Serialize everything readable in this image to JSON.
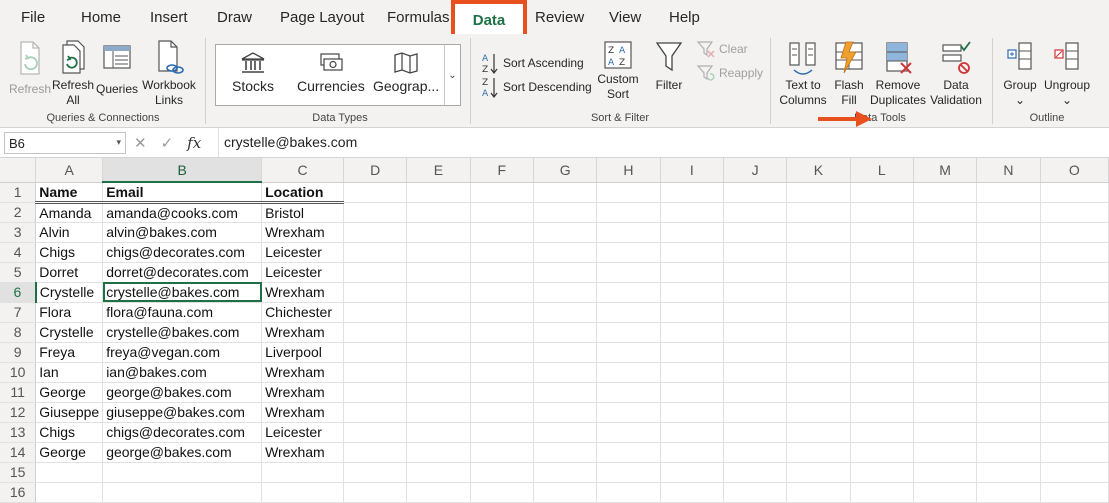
{
  "tabs": [
    "File",
    "Home",
    "Insert",
    "Draw",
    "Page Layout",
    "Formulas",
    "Data",
    "Review",
    "View",
    "Help"
  ],
  "active_tab": "Data",
  "accent_color": "#1e7145",
  "highlight_color": "#e8501e",
  "ribbon": {
    "queries": {
      "refresh": "Refresh",
      "refresh_all_1": "Refresh",
      "refresh_all_2": "All",
      "queries": "Queries",
      "workbook_links_1": "Workbook",
      "workbook_links_2": "Links",
      "group_label": "Queries & Connections"
    },
    "data_types": {
      "stocks": "Stocks",
      "currencies": "Currencies",
      "geography": "Geograp...",
      "group_label": "Data Types"
    },
    "sort_filter": {
      "sort_ascending": "Sort Ascending",
      "sort_descending": "Sort Descending",
      "custom_sort_1": "Custom",
      "custom_sort_2": "Sort",
      "filter": "Filter",
      "clear": "Clear",
      "reapply": "Reapply",
      "group_label": "Sort & Filter"
    },
    "data_tools": {
      "text_to_columns_1": "Text to",
      "text_to_columns_2": "Columns",
      "flash_fill_1": "Flash",
      "flash_fill_2": "Fill",
      "remove_duplicates_1": "Remove",
      "remove_duplicates_2": "Duplicates",
      "data_validation_1": "Data",
      "data_validation_2": "Validation",
      "group_label": "Data Tools"
    },
    "outline": {
      "group": "Group",
      "ungroup": "Ungroup",
      "group_label": "Outline"
    }
  },
  "formula_bar": {
    "name_box": "B6",
    "formula": "crystelle@bakes.com"
  },
  "sheet": {
    "columns": [
      "A",
      "B",
      "C",
      "D",
      "E",
      "F",
      "G",
      "H",
      "I",
      "J",
      "K",
      "L",
      "M",
      "N",
      "O"
    ],
    "rows": [
      {
        "n": "1",
        "a": "Name",
        "b": "Email",
        "c": "Location"
      },
      {
        "n": "2",
        "a": "Amanda",
        "b": "amanda@cooks.com",
        "c": "Bristol"
      },
      {
        "n": "3",
        "a": "Alvin",
        "b": "alvin@bakes.com",
        "c": "Wrexham"
      },
      {
        "n": "4",
        "a": "Chigs",
        "b": "chigs@decorates.com",
        "c": "Leicester"
      },
      {
        "n": "5",
        "a": "Dorret",
        "b": "dorret@decorates.com",
        "c": "Leicester"
      },
      {
        "n": "6",
        "a": "Crystelle",
        "b": "crystelle@bakes.com",
        "c": "Wrexham"
      },
      {
        "n": "7",
        "a": "Flora",
        "b": "flora@fauna.com",
        "c": "Chichester"
      },
      {
        "n": "8",
        "a": "Crystelle",
        "b": "crystelle@bakes.com",
        "c": "Wrexham"
      },
      {
        "n": "9",
        "a": "Freya",
        "b": "freya@vegan.com",
        "c": "Liverpool"
      },
      {
        "n": "10",
        "a": "Ian",
        "b": "ian@bakes.com",
        "c": "Wrexham"
      },
      {
        "n": "11",
        "a": "George",
        "b": "george@bakes.com",
        "c": "Wrexham"
      },
      {
        "n": "12",
        "a": "Giuseppe",
        "b": "giuseppe@bakes.com",
        "c": "Wrexham"
      },
      {
        "n": "13",
        "a": "Chigs",
        "b": "chigs@decorates.com",
        "c": "Leicester"
      },
      {
        "n": "14",
        "a": "George",
        "b": "george@bakes.com",
        "c": "Wrexham"
      },
      {
        "n": "15",
        "a": "",
        "b": "",
        "c": ""
      },
      {
        "n": "16",
        "a": "",
        "b": "",
        "c": ""
      }
    ]
  }
}
